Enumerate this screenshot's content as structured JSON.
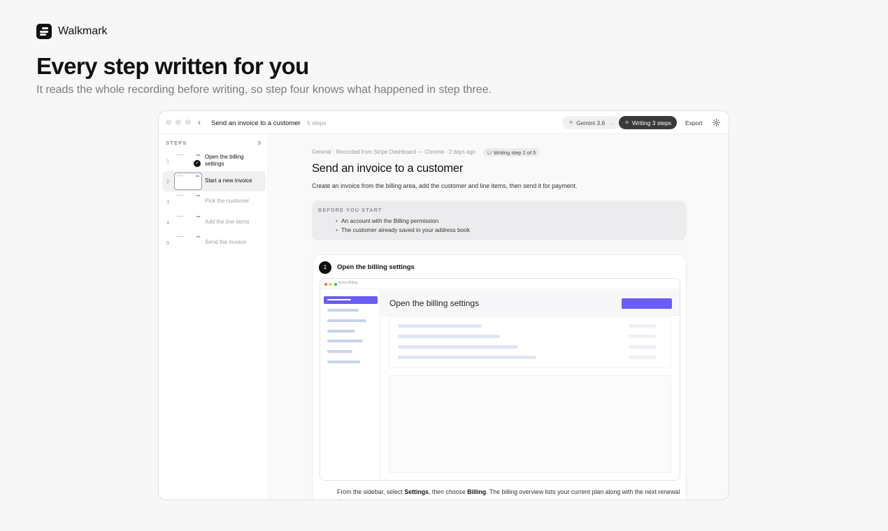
{
  "brand": {
    "name": "Walkmark"
  },
  "hero": {
    "title": "Every step written for you",
    "subtitle": "It reads the whole recording before writing, so step four knows what happened in step three."
  },
  "window": {
    "title": "Send an invoice to a customer",
    "step_count": "5 steps",
    "model": "Gemini 3.6",
    "writing_status": "Writing 3 steps",
    "export_label": "Export"
  },
  "sidebar": {
    "heading": "STEPS",
    "count": "5",
    "steps": [
      {
        "num": "1",
        "label": "Open the billing settings",
        "done": true
      },
      {
        "num": "2",
        "label": "Start a new invoice",
        "active": true
      },
      {
        "num": "3",
        "label": "Pick the customer"
      },
      {
        "num": "4",
        "label": "Add the line items"
      },
      {
        "num": "5",
        "label": "Send the invoice"
      }
    ]
  },
  "doc": {
    "meta": "General · Recorded from Stripe Dashboard — Chrome · 2 days ago",
    "writing_badge": "Writing step 2 of 5",
    "title": "Send an invoice to a customer",
    "description": "Create an invoice from the billing area, add the customer and line items, then send it for payment.",
    "prereq": {
      "title": "BEFORE YOU START",
      "items": [
        "An account with the Billing permission",
        "The customer already saved in your address book"
      ]
    },
    "step1": {
      "num": "1",
      "title": "Open the billing settings",
      "screenshot": {
        "app_label": "Acme Billing",
        "heading": "Open the billing settings"
      },
      "text_pre": "From the sidebar, select ",
      "text_b1": "Settings",
      "text_mid": ", then choose ",
      "text_b2": "Billing",
      "text_post": ". The billing overview lists your current plan along with the next renewal date."
    }
  },
  "colors": {
    "accent": "#6a5cf5",
    "dark": "#111111",
    "pill_dark": "#3a3a3d"
  }
}
